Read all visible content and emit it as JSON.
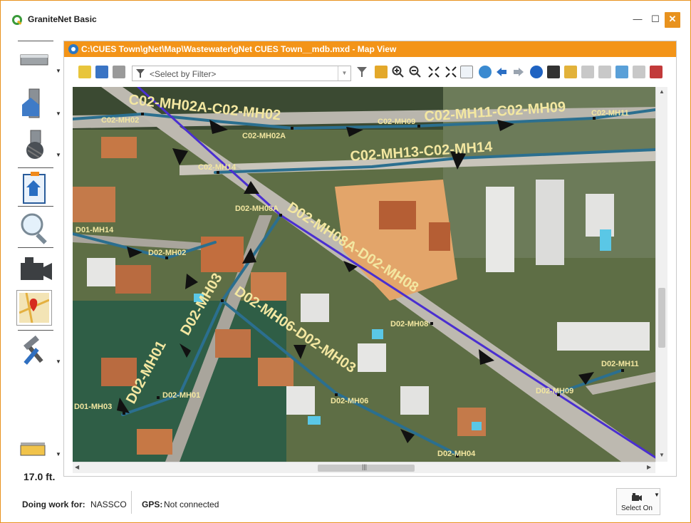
{
  "app": {
    "title": "GraniteNet Basic"
  },
  "window_controls": {
    "minimize": "—",
    "maximize": "☐",
    "close": "✕"
  },
  "left_toolbar": {
    "tools": [
      "pipe-segment-icon",
      "manhole-house-icon",
      "lateral-connection-icon",
      "import-export-icon",
      "inspect-magnifier-icon",
      "camera-icon",
      "map-view-icon",
      "tools-icon",
      "depth-gauge-icon"
    ],
    "depth": "17.0 ft."
  },
  "map_window": {
    "title": "C:\\CUES Town\\gNet\\Map\\Wastewater\\gNet CUES Town__mdb.mxd - Map View",
    "filter_placeholder": "<Select by Filter>"
  },
  "map": {
    "pipe_labels": [
      "C02-MH02A-C02-MH02",
      "C02-MH11-C02-MH09",
      "C02-MH13-C02-MH14",
      "D02-MH08A-D02-MH08",
      "D02-MH03",
      "D02-MH06-D02-MH03",
      "D02-MH01"
    ],
    "node_labels": [
      "C02-MH02",
      "C02-MH02A",
      "C02-MH09",
      "C02-MH11",
      "C02-MH14",
      "D02-MH08A",
      "D01-MH14",
      "D02-MH02",
      "D02-MH08",
      "D02-MH01",
      "D01-MH03",
      "D02-MH06",
      "D02-MH09",
      "D02-MH11",
      "D02-MH04"
    ],
    "colors": {
      "sewer_line": "#2b6f8f",
      "main_line": "#4a2fd0",
      "label": "#f3e7a1"
    }
  },
  "status": {
    "work_label": "Doing work for:",
    "work_value": "NASSCO",
    "gps_label": "GPS:",
    "gps_value": "Not connected",
    "select_on": "Select On"
  }
}
